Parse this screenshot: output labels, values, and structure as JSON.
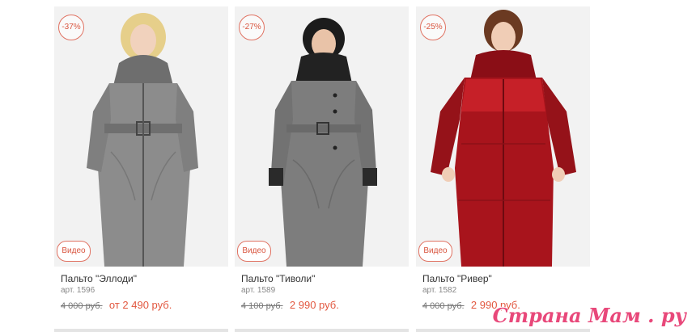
{
  "products": [
    {
      "discount": "-37%",
      "video_label": "Видео",
      "name": "Пальто \"Эллоди\"",
      "sku": "арт. 1596",
      "old_price": "4 000 руб.",
      "new_price": "от 2 490 руб.",
      "coat_color": "#8c8c8c",
      "hair_color": "#e6cf8a"
    },
    {
      "discount": "-27%",
      "video_label": "Видео",
      "name": "Пальто \"Тиволи\"",
      "sku": "арт. 1589",
      "old_price": "4 100 руб.",
      "new_price": "2 990 руб.",
      "coat_color": "#7d7d7d",
      "hair_color": "#1c1c1c"
    },
    {
      "discount": "-25%",
      "video_label": "Видео",
      "name": "Пальто \"Ривер\"",
      "sku": "арт. 1582",
      "old_price": "4 000 руб.",
      "new_price": "2 990 руб.",
      "coat_color": "#a8141c",
      "hair_color": "#6b3a22"
    }
  ],
  "watermark": "Страна Мам . ру",
  "colors": {
    "accent": "#e2573f",
    "watermark": "#e8487a"
  }
}
